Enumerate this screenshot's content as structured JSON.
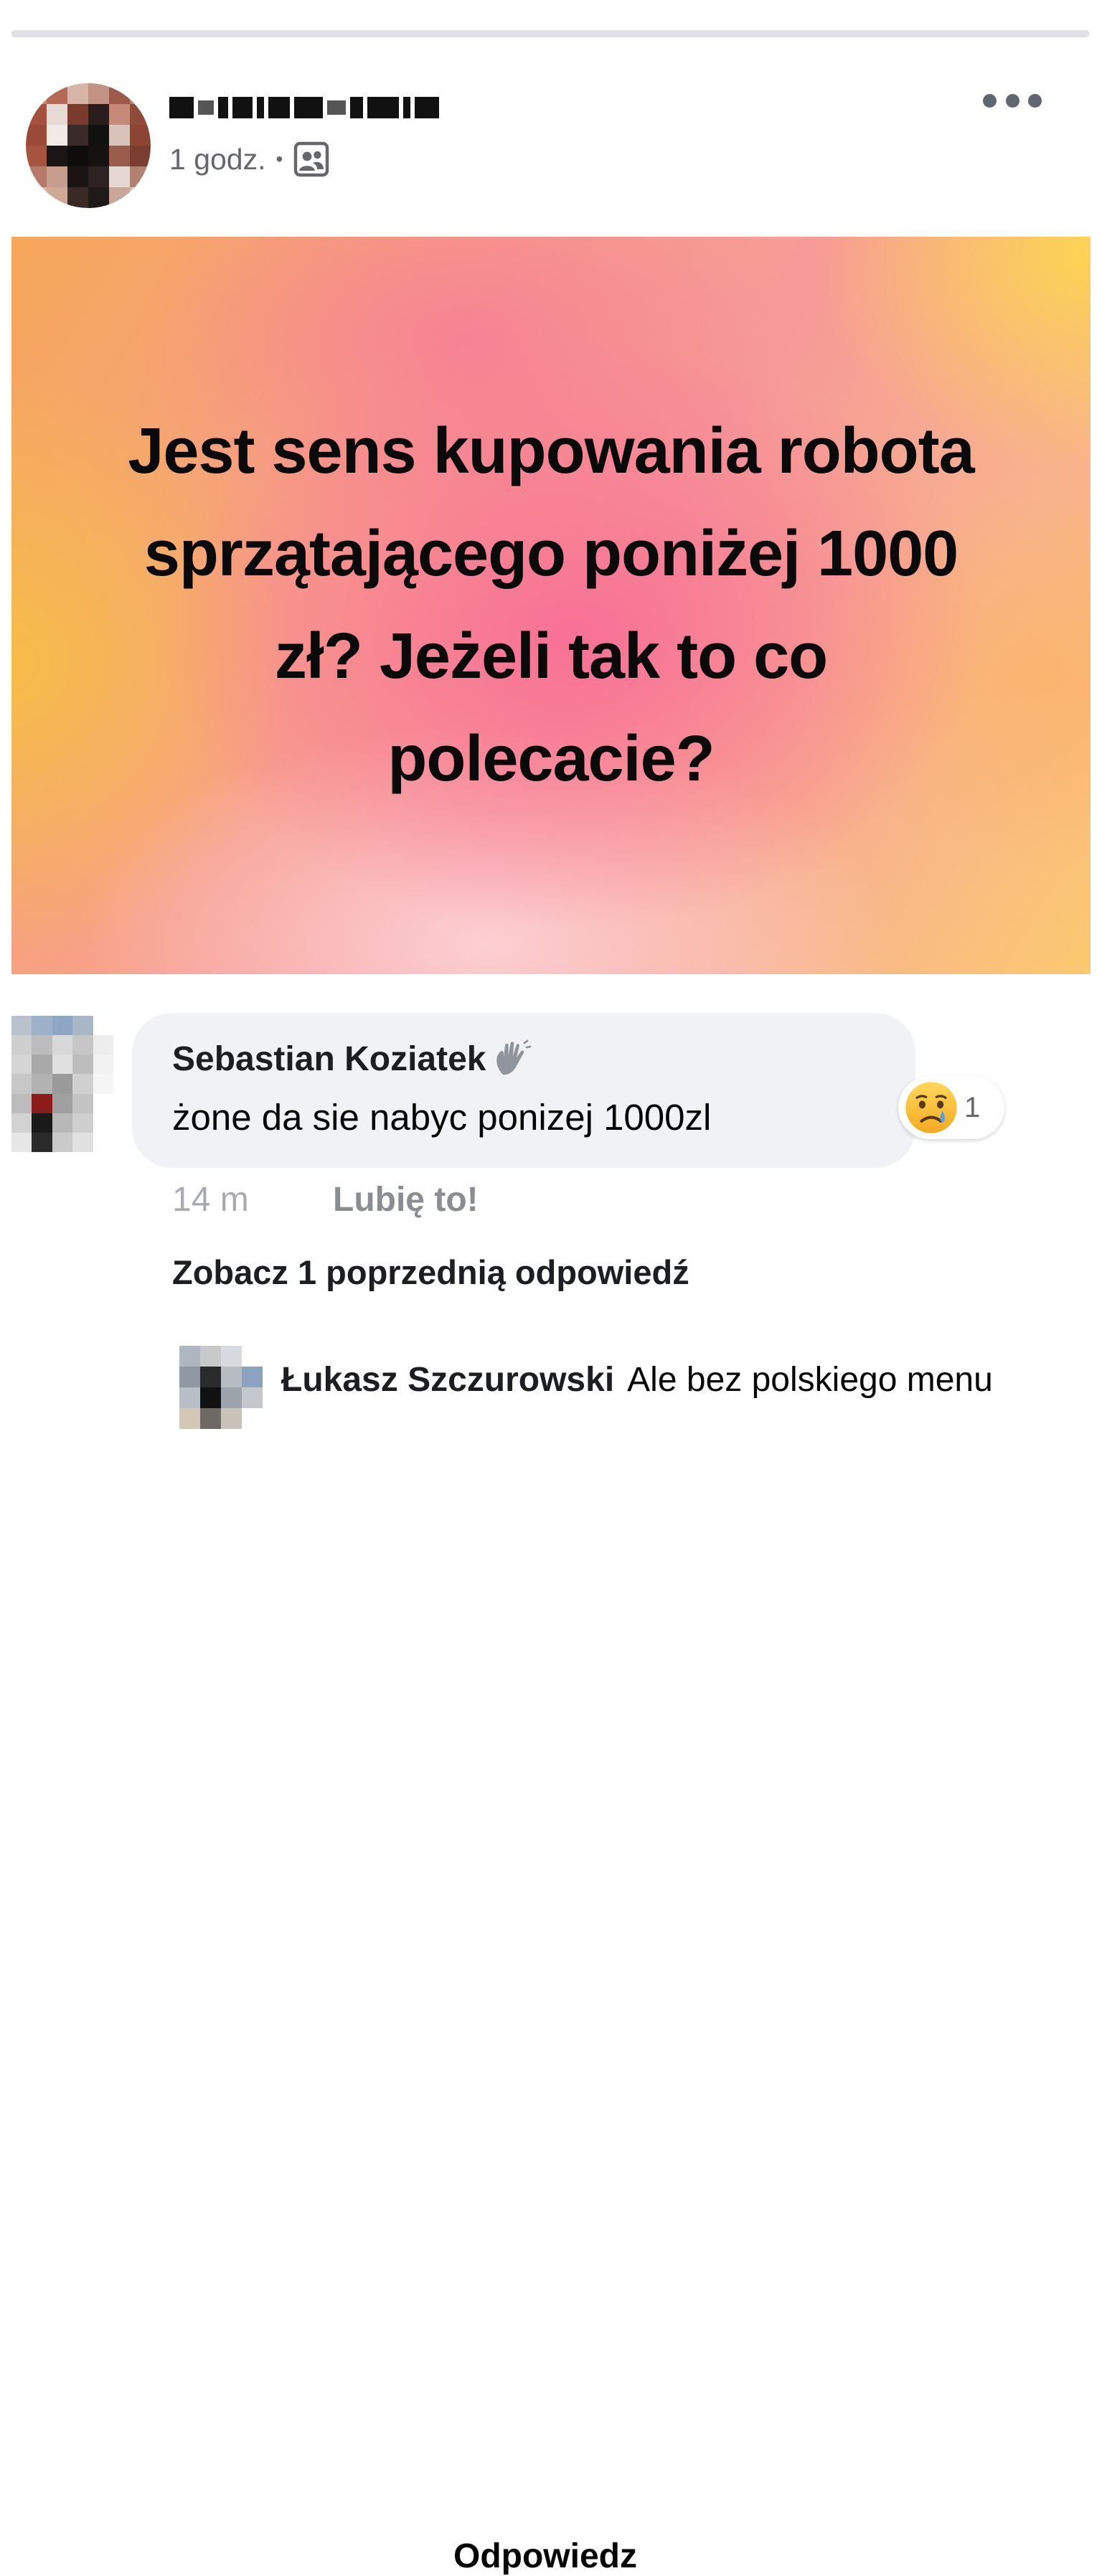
{
  "post": {
    "author_name": "",
    "time": "1 godz.",
    "separator": "•",
    "audience_icon": "group-icon",
    "more_icon": "more-horizontal-icon",
    "background_text": "Jest sens kupowania robota sprzątającego poniżej 1000 zł? Jeżeli tak to co polecacie?"
  },
  "comment": {
    "author": "Sebastian Koziatek",
    "badge_icon": "wave-hand-icon",
    "text": "żone  da sie nabyc ponizej 1000zl",
    "reaction_icon": "sad-face-icon",
    "reaction_count": "1",
    "time": "14 m",
    "like_label": "Lubię to!",
    "reply_label": "Odpowiedz"
  },
  "view_previous": "Zobacz 1 poprzednią odpowiedź",
  "reply": {
    "author": "Łukasz Szczurowski",
    "text": "Ale bez polskiego menu"
  },
  "colors": {
    "secondary_text": "#65676b",
    "bubble_bg": "#f0f2f5",
    "gradient_pink": "#f66e96",
    "gradient_orange": "#f5a85a",
    "gradient_yellow": "#fcd650"
  }
}
